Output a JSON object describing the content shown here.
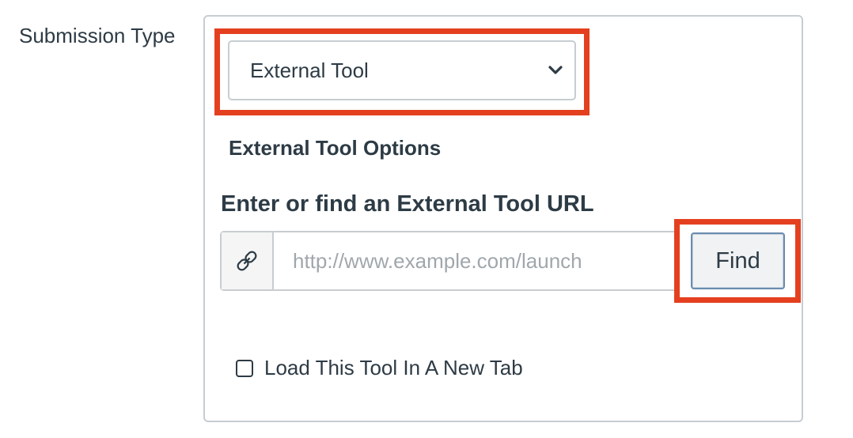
{
  "form": {
    "submission_type_label": "Submission Type",
    "submission_type_value": "External Tool",
    "options_title": "External Tool Options",
    "url_label": "Enter or find an External Tool URL",
    "url_value": "",
    "url_placeholder": "http://www.example.com/launch",
    "find_button_label": "Find",
    "new_tab_label": "Load This Tool In A New Tab",
    "new_tab_checked": false
  },
  "icons": {
    "select_arrow": "chevron-down-icon",
    "url_addon": "link-icon"
  },
  "colors": {
    "highlight": "#e4401f",
    "text": "#2d3b45",
    "border": "#c7cdd1",
    "button_border": "#6a8cae"
  }
}
